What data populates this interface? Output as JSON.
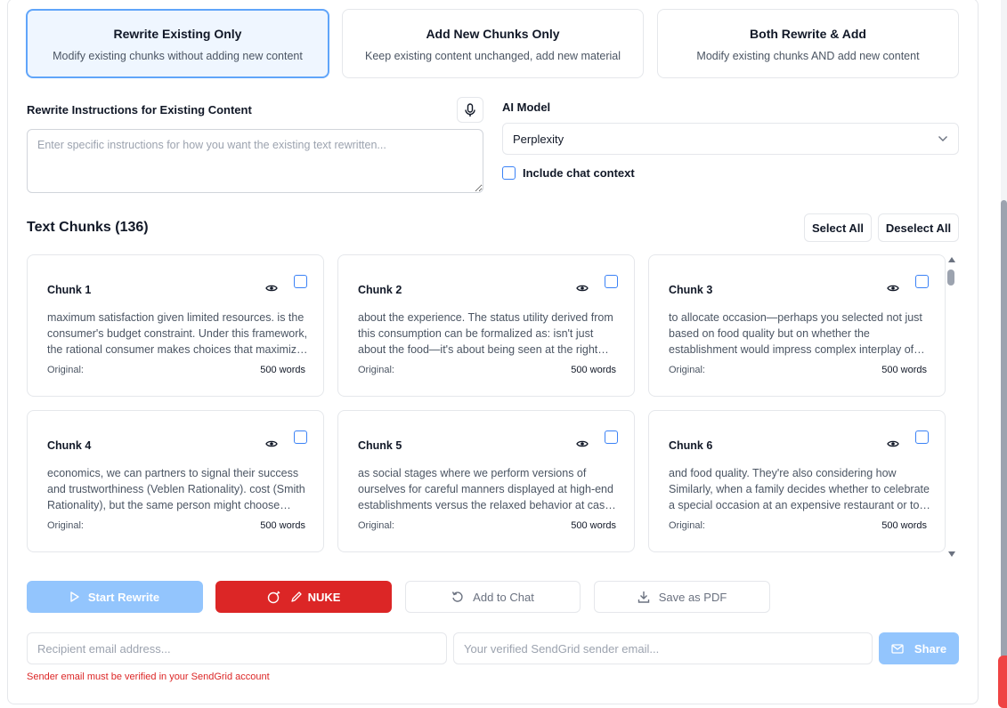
{
  "modes": [
    {
      "title": "Rewrite Existing Only",
      "desc": "Modify existing chunks without adding new content",
      "active": true
    },
    {
      "title": "Add New Chunks Only",
      "desc": "Keep existing content unchanged, add new material",
      "active": false
    },
    {
      "title": "Both Rewrite & Add",
      "desc": "Modify existing chunks AND add new content",
      "active": false
    }
  ],
  "instructions": {
    "label": "Rewrite Instructions for Existing Content",
    "placeholder": "Enter specific instructions for how you want the existing text rewritten..."
  },
  "model": {
    "label": "AI Model",
    "selected": "Perplexity",
    "include_context_label": "Include chat context"
  },
  "chunks_header": {
    "title": "Text Chunks (136)",
    "select_all": "Select All",
    "deselect_all": "Deselect All"
  },
  "chunks": [
    {
      "title": "Chunk 1",
      "text": "maximum satisfaction given limited resources. is the consumer's budget constraint. Under this framework, the rational consumer makes choices that maximize utility subject to their constraints.",
      "original": "Original:",
      "words": "500 words"
    },
    {
      "title": "Chunk 2",
      "text": "about the experience. The status utility derived from this consumption can be formalized as: isn't just about the food—it's about being seen at the right places with the right people.",
      "original": "Original:",
      "words": "500 words"
    },
    {
      "title": "Chunk 3",
      "text": "to allocate occasion—perhaps you selected not just based on food quality but on whether the establishment would impress complex interplay of motivations and social signals.",
      "original": "Original:",
      "words": "500 words"
    },
    {
      "title": "Chunk 4",
      "text": "economics, we can partners to signal their success and trustworthiness (Veblen Rationality). cost (Smith Rationality), but the same person might choose differently in another setting.",
      "original": "Original:",
      "words": "500 words"
    },
    {
      "title": "Chunk 5",
      "text": "as social stages where we perform versions of ourselves for careful manners displayed at high-end establishments versus the relaxed behavior at casual diners and local spots.",
      "original": "Original:",
      "words": "500 words"
    },
    {
      "title": "Chunk 6",
      "text": "and food quality. They're also considering how Similarly, when a family decides whether to celebrate a special occasion at an expensive restaurant or to stay at home instead.",
      "original": "Original:",
      "words": "500 words"
    }
  ],
  "actions": {
    "start": "Start Rewrite",
    "nuke": "NUKE",
    "add_chat": "Add to Chat",
    "save_pdf": "Save as PDF"
  },
  "email": {
    "recipient_placeholder": "Recipient email address...",
    "sender_placeholder": "Your verified SendGrid sender email...",
    "share": "Share",
    "warning": "Sender email must be verified in your SendGrid account"
  },
  "colors": {
    "accent": "#3b82f6",
    "accent_light": "#93c5fd",
    "danger": "#dc2626"
  }
}
